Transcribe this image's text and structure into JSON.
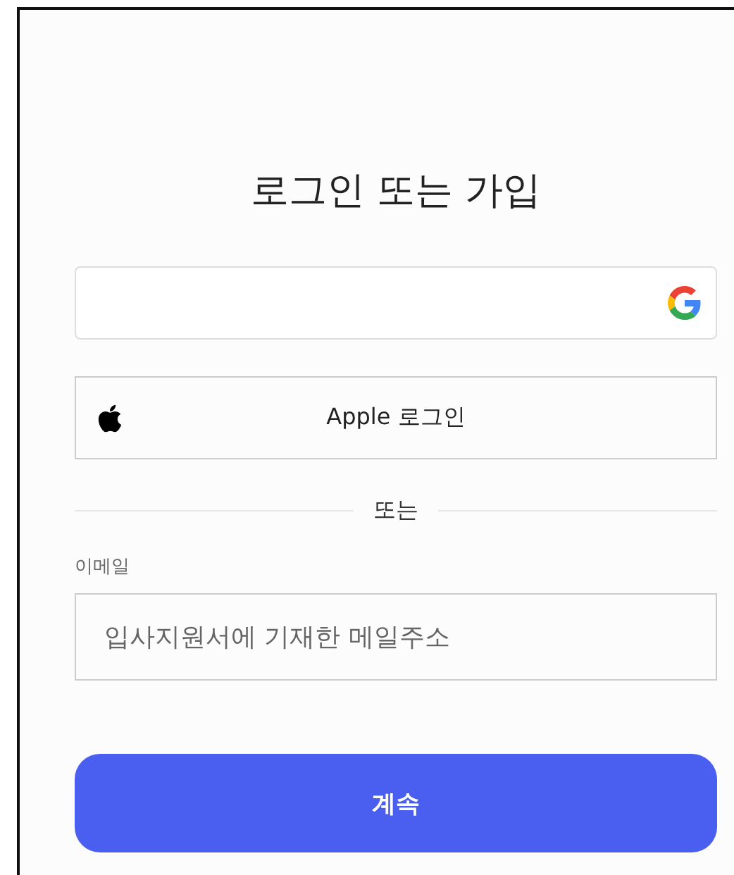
{
  "title": "로그인 또는 가입",
  "apple_button": {
    "label": "Apple 로그인"
  },
  "divider": {
    "label": "또는"
  },
  "email": {
    "label": "이메일",
    "placeholder": "입사지원서에 기재한 메일주소"
  },
  "continue_button": {
    "label": "계속"
  }
}
